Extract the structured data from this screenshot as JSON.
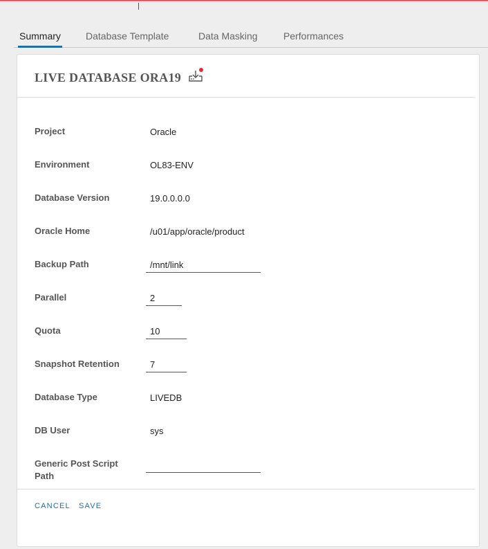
{
  "tabs": [
    {
      "label": "Summary",
      "active": true
    },
    {
      "label": "Database Template",
      "active": false
    },
    {
      "label": "Data Masking",
      "active": false
    },
    {
      "label": "Performances",
      "active": false
    }
  ],
  "card": {
    "title": "LIVE DATABASE ORA19",
    "icon": "download-tray-icon",
    "icon_badge_color": "#e02b3c"
  },
  "fields": {
    "project": {
      "label": "Project",
      "value": "Oracle"
    },
    "environment": {
      "label": "Environment",
      "value": "OL83-ENV"
    },
    "database_version": {
      "label": "Database Version",
      "value": "19.0.0.0.0"
    },
    "oracle_home": {
      "label": "Oracle Home",
      "value": "/u01/app/oracle/product"
    },
    "backup_path": {
      "label": "Backup Path",
      "value": "/mnt/link"
    },
    "parallel": {
      "label": "Parallel",
      "value": "2"
    },
    "quota": {
      "label": "Quota",
      "value": "10"
    },
    "snapshot_retention": {
      "label": "Snapshot Retention",
      "value": "7"
    },
    "database_type": {
      "label": "Database Type",
      "value": "LIVEDB"
    },
    "db_user": {
      "label": "DB User",
      "value": "sys"
    },
    "generic_post_script_path": {
      "label": "Generic Post Script Path",
      "value": ""
    }
  },
  "actions": {
    "cancel_label": "CANCEL",
    "save_label": "SAVE"
  },
  "colors": {
    "accent": "#1f6ea8",
    "top_bar": "#e02b3c"
  }
}
